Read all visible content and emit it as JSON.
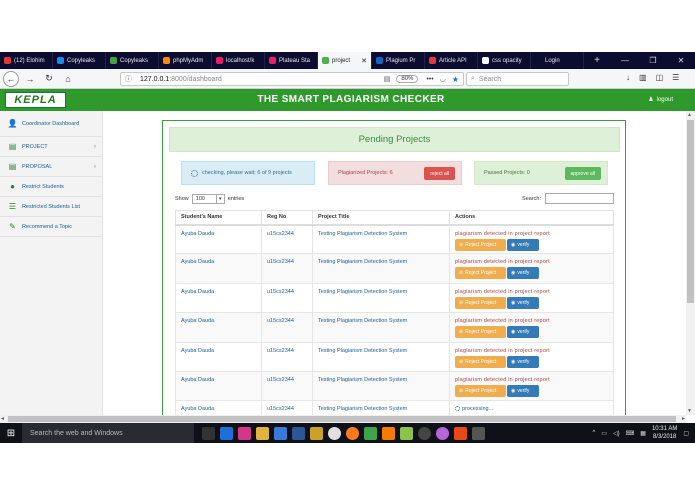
{
  "browser": {
    "tabs": [
      {
        "label": "(12) Elohim",
        "color": "#e53935"
      },
      {
        "label": "Copyleaks",
        "color": "#1e88e5"
      },
      {
        "label": "Copyleaks",
        "color": "#43a047"
      },
      {
        "label": "phpMyAdm",
        "color": "#fb8c00"
      },
      {
        "label": "localhost/k",
        "color": "#e91e63"
      },
      {
        "label": "Plateau Sta",
        "color": "#e91e63"
      },
      {
        "label": "project",
        "color": "#4caf50",
        "active": true
      },
      {
        "label": "Plagium Pr",
        "color": "#1565c0"
      },
      {
        "label": "Article API",
        "color": "#e53935"
      },
      {
        "label": "css opacity",
        "color": "#fafafa"
      },
      {
        "label": "Login",
        "color": "#0c0c30"
      }
    ],
    "new_tab": "+",
    "url_host": "127.0.0.1",
    "url_path": ":8000/dashboard",
    "zoom": "80%",
    "search_placeholder": "Search"
  },
  "app": {
    "logo": "KEPLA",
    "title": "THE SMART PLAGIARISM CHECKER",
    "logout": "logout"
  },
  "sidebar": {
    "items": [
      {
        "label": "Coordinator Dashboard",
        "icon": "user-icon",
        "glyph": "👤"
      },
      {
        "label": "PROJECT",
        "icon": "book-icon",
        "glyph": "▤",
        "chevron": "‹"
      },
      {
        "label": "PROPOSAL",
        "icon": "book-icon",
        "glyph": "▤",
        "chevron": "‹"
      },
      {
        "label": "Restrict Students",
        "icon": "info-icon",
        "glyph": "●"
      },
      {
        "label": "Restricted Students List",
        "icon": "list-icon",
        "glyph": "☰"
      },
      {
        "label": "Recommend a Topic",
        "icon": "edit-icon",
        "glyph": "✎"
      }
    ]
  },
  "main": {
    "header": "Pending Projects",
    "checking": "checking, please wait: 6 of 9 projects",
    "plagiarized": "Plagiarized Projects: 6",
    "reject_all": "reject all",
    "passed": "Passed Projects: 0",
    "approve_all": "approve all",
    "show_label": "Show",
    "show_value": "100",
    "entries_label": "entries",
    "search_label": "Search:",
    "columns": [
      "Student's Name",
      "Reg No",
      "Project Title",
      "Actions"
    ],
    "rows": [
      {
        "name": "Ayuba Dauda",
        "reg": "u15cs2344",
        "title": "Testing Plagiarism Detection System",
        "status": "plagiarism detected in project report"
      },
      {
        "name": "Ayuba Dauda",
        "reg": "u15cs2344",
        "title": "Testing Plagiarism Detection System",
        "status": "plagiarism detected in project report"
      },
      {
        "name": "Ayuba Dauda",
        "reg": "u15cs2344",
        "title": "Testing Plagiarism Detection System",
        "status": "plagiarism detected in project report"
      },
      {
        "name": "Ayuba Dauda",
        "reg": "u15cs2344",
        "title": "Testing Plagiarism Detection System",
        "status": "plagiarism detected in project report"
      },
      {
        "name": "Ayuba Dauda",
        "reg": "u15cs2344",
        "title": "Testing Plagiarism Detection System",
        "status": "plagiarism detected in project report"
      },
      {
        "name": "Ayuba Dauda",
        "reg": "u15cs2344",
        "title": "Testing Plagiarism Detection System",
        "status": "plagiarism detected in project report"
      },
      {
        "name": "Ayuba Dauda",
        "reg": "u15cs2344",
        "title": "Testing Plagiarism Detection System",
        "status": "processing..."
      }
    ],
    "reject_label": "Reject Project",
    "verify_label": "verify"
  },
  "taskbar": {
    "search_placeholder": "Search the web and Windows",
    "time": "10:31 AM",
    "date": "8/3/2018"
  },
  "colors": {
    "brand": "#2f9a2b",
    "danger": "#d9534f",
    "warning": "#f0ad4e",
    "primary": "#337ab7",
    "success": "#5cb85c"
  }
}
